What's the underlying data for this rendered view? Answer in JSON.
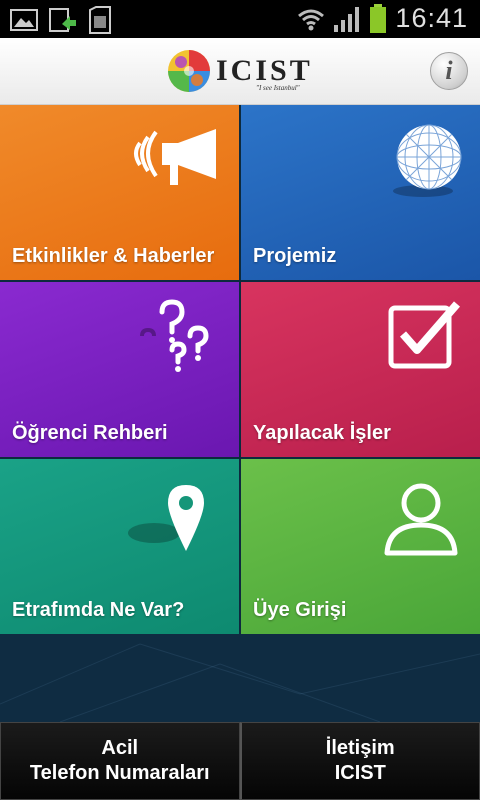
{
  "status_bar": {
    "time": "16:41",
    "icons": [
      "gallery-notification-icon",
      "download-notification-icon",
      "sd-card-icon",
      "wifi-icon",
      "signal-icon",
      "battery-icon"
    ]
  },
  "header": {
    "logo_text": "ICIST",
    "logo_tagline": "\"I see Istanbul\"",
    "info_label": "i"
  },
  "tiles": [
    {
      "label": "Etkinlikler & Haberler",
      "icon": "megaphone-icon",
      "color": "#e97a18"
    },
    {
      "label": "Projemiz",
      "icon": "globe-icon",
      "color": "#2366b9"
    },
    {
      "label": "Öğrenci Rehberi",
      "icon": "question-marks-icon",
      "color": "#7b22c2"
    },
    {
      "label": "Yapılacak İşler",
      "icon": "checkbox-icon",
      "color": "#c92855"
    },
    {
      "label": "Etrafımda Ne Var?",
      "icon": "map-pin-icon",
      "color": "#159679"
    },
    {
      "label": "Üye Girişi",
      "icon": "user-icon",
      "color": "#5cb542"
    }
  ],
  "bottom_buttons": [
    {
      "line1": "Acil",
      "line2": "Telefon Numaraları"
    },
    {
      "line1": "İletişim",
      "line2": "ICIST"
    }
  ]
}
